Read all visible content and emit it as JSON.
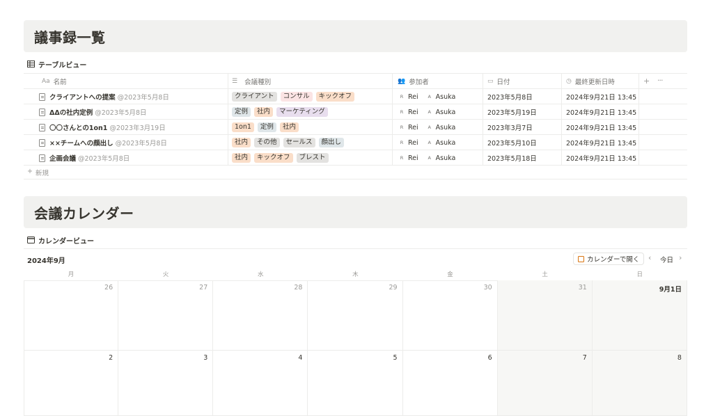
{
  "section1": {
    "title": "議事録一覧",
    "view_label": "テーブルビュー"
  },
  "table": {
    "headers": {
      "name": "名前",
      "name_icon": "Aa",
      "type": "会議種別",
      "type_icon": "list-icon",
      "participants": "参加者",
      "participants_icon": "people-icon",
      "date": "日付",
      "date_icon": "calendar-icon",
      "updated": "最終更新日時",
      "updated_icon": "clock-icon",
      "add": "+",
      "more": "···"
    },
    "rows": [
      {
        "title": "クライアントへの提案",
        "mention": "@2023年5月8日",
        "tags": [
          "クライアント",
          "コンサル",
          "キックオフ"
        ],
        "p1": "Rei",
        "p1_initial": "R",
        "p2": "Asuka",
        "p2_initial": "A",
        "date": "2023年5月8日",
        "updated": "2024年9月21日 13:45"
      },
      {
        "title": "ΔΔの社内定例",
        "mention": "@2023年5月8日",
        "tags": [
          "定例",
          "社内",
          "マーケティング"
        ],
        "p1": "Rei",
        "p1_initial": "R",
        "p2": "Asuka",
        "p2_initial": "A",
        "date": "2023年5月19日",
        "updated": "2024年9月21日 13:45"
      },
      {
        "title": "〇〇さんとの1on1",
        "mention": "@2023年3月19日",
        "tags": [
          "1on1",
          "定例",
          "社内"
        ],
        "p1": "Rei",
        "p1_initial": "R",
        "p2": "Asuka",
        "p2_initial": "A",
        "date": "2023年3月7日",
        "updated": "2024年9月21日 13:45"
      },
      {
        "title": "××チームへの顔出し",
        "mention": "@2023年5月8日",
        "tags": [
          "社内",
          "その他",
          "セールス",
          "顔出し"
        ],
        "p1": "Rei",
        "p1_initial": "R",
        "p2": "Asuka",
        "p2_initial": "A",
        "date": "2023年5月10日",
        "updated": "2024年9月21日 13:45"
      },
      {
        "title": "企画会議",
        "mention": "@2023年5月8日",
        "tags": [
          "社内",
          "キックオフ",
          "ブレスト"
        ],
        "p1": "Rei",
        "p1_initial": "R",
        "p2": "Asuka",
        "p2_initial": "A",
        "date": "2023年5月18日",
        "updated": "2024年9月21日 13:45"
      }
    ],
    "new_label": "新規"
  },
  "tag_colors": {
    "クライアント": "#e3e2e0",
    "コンサル": "#fbe4e4",
    "キックオフ": "#fadec9",
    "定例": "#dfe6e9",
    "社内": "#fadec9",
    "マーケティング": "#e8deee",
    "1on1": "#fadec9",
    "その他": "#e3e2e0",
    "セールス": "#e3e2e0",
    "顔出し": "#dfe6e9",
    "ブレスト": "#e3e2e0"
  },
  "section2": {
    "title": "会議カレンダー",
    "view_label": "カレンダービュー"
  },
  "calendar": {
    "month_label": "2024年9月",
    "open_button": "カレンダーで開く",
    "today": "今日",
    "weekdays": [
      "月",
      "火",
      "水",
      "木",
      "金",
      "土",
      "日"
    ],
    "weeks": [
      [
        "26",
        "27",
        "28",
        "29",
        "30",
        "31",
        "9月1日"
      ],
      [
        "2",
        "3",
        "4",
        "5",
        "6",
        "7",
        "8"
      ]
    ]
  }
}
